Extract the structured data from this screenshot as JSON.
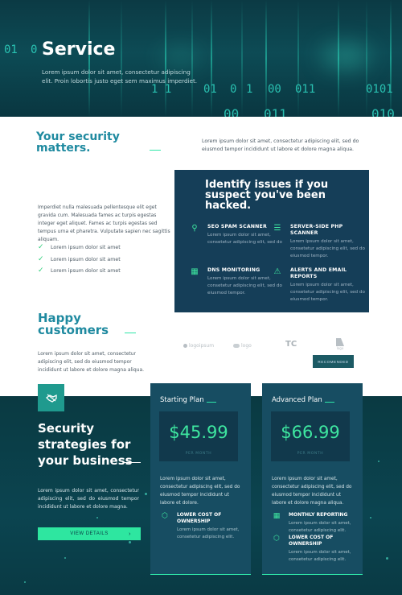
{
  "hero": {
    "title": "Service",
    "subtitle": "Lorem ipsum dolor sit amet, consectetur adipiscing elit. Proin lobortis justo eget sem maximus imperdiet.",
    "binary": [
      "01",
      "0",
      "1 1",
      "01",
      "0",
      "1",
      "00",
      "011",
      "0101",
      "00",
      "011",
      "010"
    ]
  },
  "security": {
    "title_line1": "Your security",
    "title_line2": "matters.",
    "right_text": "Lorem ipsum dolor sit amet, consectetur adipiscing elit, sed do eiusmod tempor incididunt ut labore et dolore magna aliqua.",
    "paragraph": "Imperdiet nulla malesuada pellentesque elit eget gravida cum. Malesuada fames ac turpis egestas integer eget aliquet. Fames ac turpis egestas sed tempus urna et pharetra. Vulputate sapien nec sagittis aliquam.",
    "checks": [
      "Lorem ipsum dolor sit amet",
      "Lorem ipsum dolor sit amet",
      "Lorem ipsum dolor sit amet"
    ]
  },
  "issues": {
    "title": "Identify issues if you suspect you've been hacked.",
    "features": [
      {
        "icon": "search-icon",
        "title": "SEO SPAM SCANNER",
        "desc": "Lorem ipsum dolor sit amet, consetetur adipiscing elit, sed do"
      },
      {
        "icon": "server-icon",
        "title": "SERVER-SIDE PHP SCANNER",
        "desc": "Lorem ipsum dolor sit amet, consetetur adipiscing elit, sed do eiusmod tempor."
      },
      {
        "icon": "network-icon",
        "title": "DNS MONITORING",
        "desc": "Lorem ipsum dolor sit amet, consetetur adipiscing elit, sed do eiusmod tempor."
      },
      {
        "icon": "alert-icon",
        "title": "ALERTS AND EMAIL REPORTS",
        "desc": "Lorem ipsum dolor sit amet, consetetur adipiscing elit, sed do eiusmod tempor."
      }
    ]
  },
  "happy": {
    "title_line1": "Happy",
    "title_line2": "customers",
    "paragraph": "Lorem ipsum dolor sit amet, consectetur adipiscing elit, sed do eiusmod tempor incididunt ut labore et dolore magna aliqua.",
    "logos": [
      "logoipsum",
      "logo",
      "TC",
      "logo"
    ],
    "button": "RECOMENDED"
  },
  "strategy": {
    "title": "Security strategies for your business",
    "paragraph": "Lorem ipsum dolor sit amet, consectetur adipiscing elit, sed do eiusmod tempor incididunt ut labore et dolore magna.",
    "button": "VIEW DETAILS"
  },
  "plans": [
    {
      "name": "Starting Plan",
      "price": "$45.99",
      "per": "PER MONTH",
      "desc": "Lorem ipsum dolor sit amet, consectetur adipiscing elit, sed do eiusmod tempor incididunt ut labore et dolore.",
      "features": [
        {
          "icon": "cube-icon",
          "title": "LOWER COST OF OWNERSHIP",
          "desc": "Lorem ipsum dolor sit amet, consetetur adipiscing elit."
        }
      ]
    },
    {
      "name": "Advanced Plan",
      "price": "$66.99",
      "per": "PER MONTH",
      "desc": "Lorem ipsum dolor sit amet, consectetur adipiscing elit, sed do eiusmod tempor incididunt ut labore et dolore magna aliqua.",
      "features": [
        {
          "icon": "network-icon",
          "title": "MONTHLY REPORTING",
          "desc": "Lorem ipsum dolor sit amet, consetetur adipiscing elit."
        },
        {
          "icon": "cube-icon",
          "title": "LOWER COST OF OWNERSHIP",
          "desc": "Lorem ipsum dolor sit amet, consetetur adipiscing elit."
        }
      ]
    }
  ],
  "colors": {
    "accent": "#2ee6a0",
    "dark_teal": "#0b3a44",
    "navy_card": "#153e58",
    "heading_teal": "#1f8aa0"
  }
}
